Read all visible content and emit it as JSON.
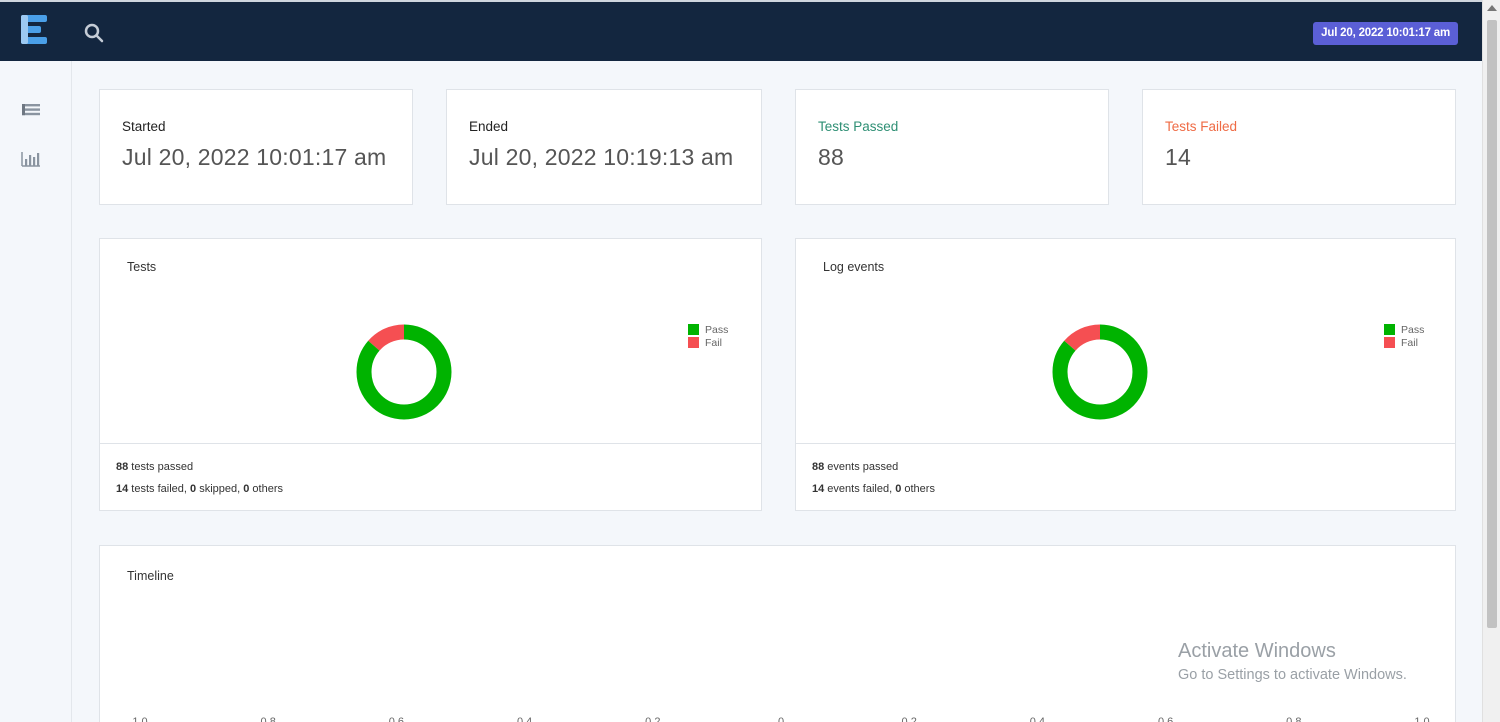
{
  "header": {
    "timestamp": "Jul 20, 2022 10:01:17 am"
  },
  "stats": [
    {
      "label": "Started",
      "value": "Jul 20, 2022 10:01:17 am",
      "status": "neutral"
    },
    {
      "label": "Ended",
      "value": "Jul 20, 2022 10:19:13 am",
      "status": "neutral"
    },
    {
      "label": "Tests Passed",
      "value": "88",
      "status": "pass"
    },
    {
      "label": "Tests Failed",
      "value": "14",
      "status": "fail"
    }
  ],
  "tests_chart": {
    "title": "Tests",
    "legend": [
      "Pass",
      "Fail"
    ],
    "foot_line1": {
      "n1": "88",
      "t1": " tests passed"
    },
    "foot_line2": {
      "n1": "14",
      "t1": " tests failed, ",
      "n2": "0",
      "t2": " skipped, ",
      "n3": "0",
      "t3": " others"
    }
  },
  "log_chart": {
    "title": "Log events",
    "legend": [
      "Pass",
      "Fail"
    ],
    "foot_line1": {
      "n1": "88",
      "t1": " events passed"
    },
    "foot_line2": {
      "n1": "14",
      "t1": " events failed, ",
      "n2": "0",
      "t2": " others"
    }
  },
  "timeline": {
    "title": "Timeline",
    "ticks": [
      "1.0",
      "0.8",
      "0.6",
      "0.4",
      "0.2",
      "0",
      "0.2",
      "0.4",
      "0.6",
      "0.8",
      "1.0"
    ]
  },
  "watermark": {
    "title": "Activate Windows",
    "subtitle": "Go to Settings to activate Windows."
  },
  "colors": {
    "pass": "#00b300",
    "fail": "#f54f52",
    "navbar": "#13263f",
    "badge": "#5b5fd6"
  },
  "chart_data": [
    {
      "type": "pie",
      "title": "Tests",
      "categories": [
        "Pass",
        "Fail"
      ],
      "values": [
        88,
        14
      ],
      "legend": "right"
    },
    {
      "type": "pie",
      "title": "Log events",
      "categories": [
        "Pass",
        "Fail"
      ],
      "values": [
        88,
        14
      ],
      "legend": "right"
    }
  ]
}
